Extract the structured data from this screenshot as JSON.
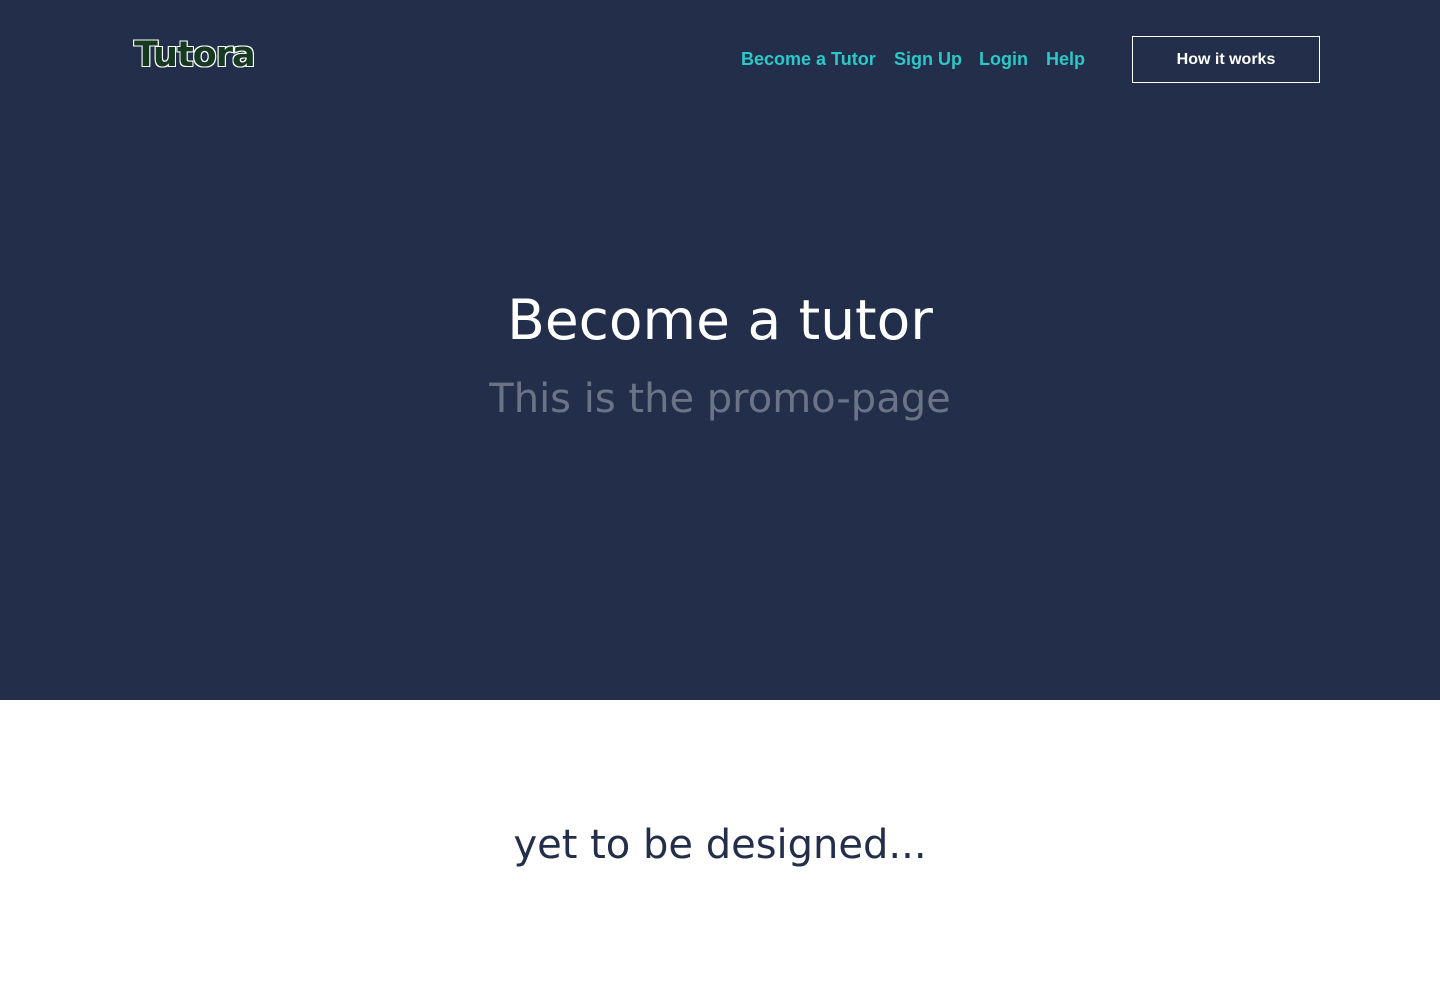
{
  "header": {
    "logo_text": "Tutora",
    "nav": {
      "become_tutor": "Become a Tutor",
      "sign_up": "Sign Up",
      "login": "Login",
      "help": "Help"
    },
    "how_it_works_label": "How it works"
  },
  "hero": {
    "title": "Become a tutor",
    "subtitle": "This is the promo-page"
  },
  "lower": {
    "text": "yet to be designed..."
  },
  "colors": {
    "hero_background": "#232f4a",
    "nav_link": "#2bc8c8",
    "logo_fill": "#163a20",
    "subtitle": "#6b7487",
    "lower_text": "#232f4a"
  }
}
